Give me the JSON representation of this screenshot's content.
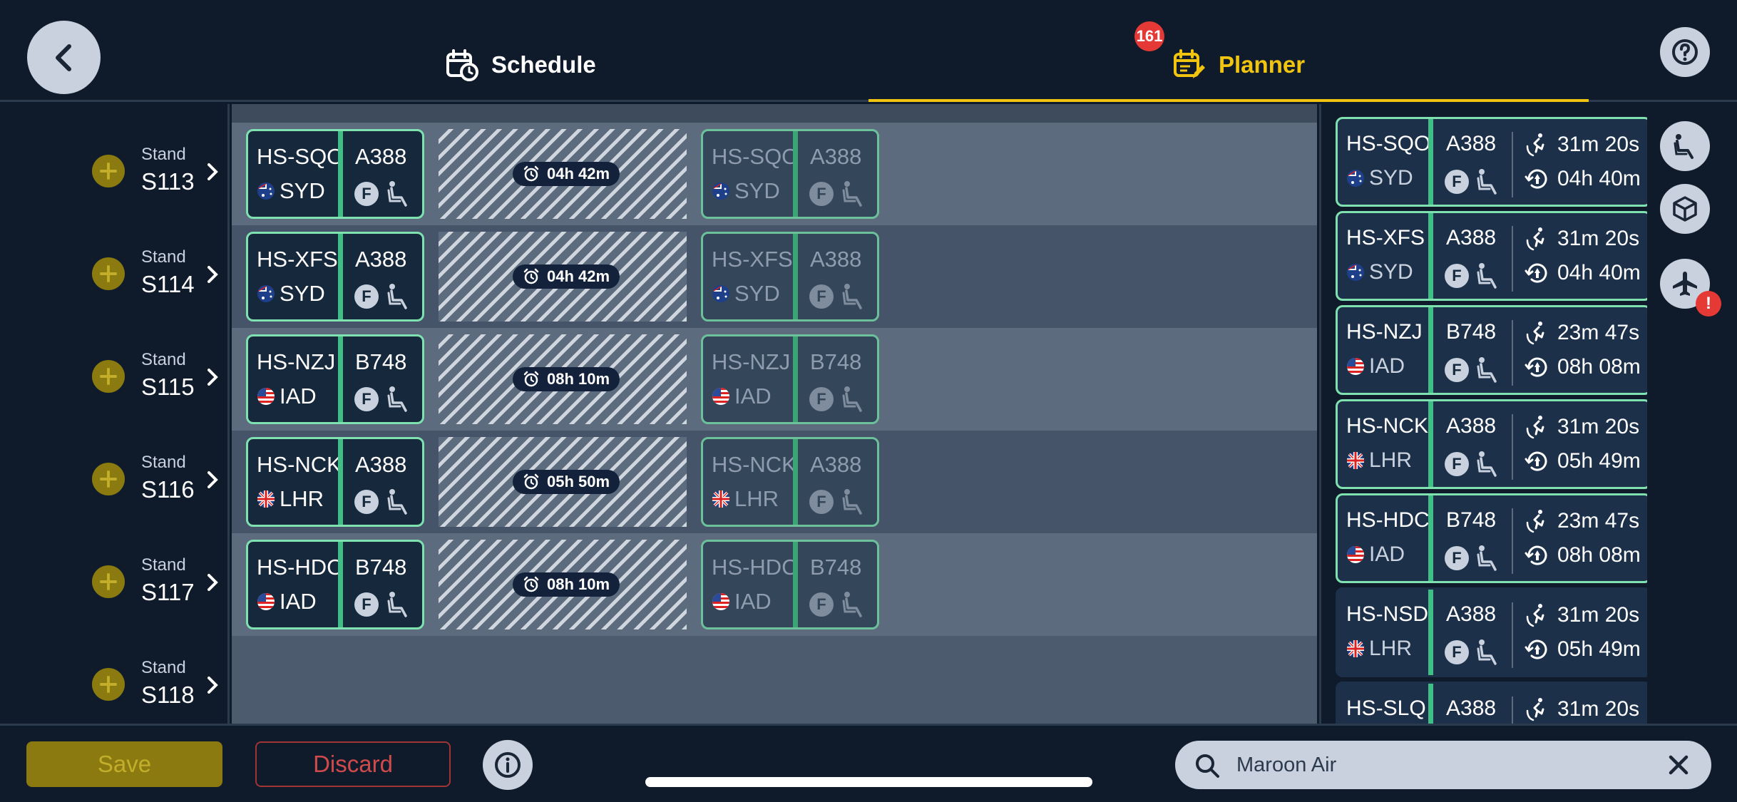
{
  "header": {
    "tabs": [
      {
        "label": "Schedule",
        "icon": "calendar-clock-icon"
      },
      {
        "label": "Planner",
        "icon": "calendar-edit-icon",
        "badge": "161"
      }
    ]
  },
  "stands": [
    {
      "label": "Stand",
      "name": "S113"
    },
    {
      "label": "Stand",
      "name": "S114"
    },
    {
      "label": "Stand",
      "name": "S115"
    },
    {
      "label": "Stand",
      "name": "S116"
    },
    {
      "label": "Stand",
      "name": "S117"
    },
    {
      "label": "Stand",
      "name": "S118"
    }
  ],
  "timeline": [
    {
      "reg": "HS-SQO",
      "origin": "SYD",
      "flag": "au",
      "type": "A388",
      "class": "F",
      "duration": "04h 42m"
    },
    {
      "reg": "HS-XFS",
      "origin": "SYD",
      "flag": "au",
      "type": "A388",
      "class": "F",
      "duration": "04h 42m"
    },
    {
      "reg": "HS-NZJ",
      "origin": "IAD",
      "flag": "us",
      "type": "B748",
      "class": "F",
      "duration": "08h 10m"
    },
    {
      "reg": "HS-NCK",
      "origin": "LHR",
      "flag": "gb",
      "type": "A388",
      "class": "F",
      "duration": "05h 50m"
    },
    {
      "reg": "HS-HDC",
      "origin": "IAD",
      "flag": "us",
      "type": "B748",
      "class": "F",
      "duration": "08h 10m"
    }
  ],
  "flights": [
    {
      "reg": "HS-SQO",
      "origin": "SYD",
      "flag": "au",
      "type": "A388",
      "class": "F",
      "time1": "31m 20s",
      "time2": "04h 40m",
      "selected": true
    },
    {
      "reg": "HS-XFS",
      "origin": "SYD",
      "flag": "au",
      "type": "A388",
      "class": "F",
      "time1": "31m 20s",
      "time2": "04h 40m",
      "selected": true
    },
    {
      "reg": "HS-NZJ",
      "origin": "IAD",
      "flag": "us",
      "type": "B748",
      "class": "F",
      "time1": "23m 47s",
      "time2": "08h 08m",
      "selected": true
    },
    {
      "reg": "HS-NCK",
      "origin": "LHR",
      "flag": "gb",
      "type": "A388",
      "class": "F",
      "time1": "31m 20s",
      "time2": "05h 49m",
      "selected": true
    },
    {
      "reg": "HS-HDC",
      "origin": "IAD",
      "flag": "us",
      "type": "B748",
      "class": "F",
      "time1": "23m 47s",
      "time2": "08h 08m",
      "selected": true
    },
    {
      "reg": "HS-NSD",
      "origin": "LHR",
      "flag": "gb",
      "type": "A388",
      "class": "F",
      "time1": "31m 20s",
      "time2": "05h 49m",
      "selected": false
    },
    {
      "reg": "HS-SLQ",
      "origin": "",
      "flag": "",
      "type": "A388",
      "class": "",
      "time1": "31m 20s",
      "time2": "",
      "selected": false
    }
  ],
  "side_buttons": [
    {
      "icon": "passenger-seat-icon"
    },
    {
      "icon": "cargo-box-icon"
    },
    {
      "icon": "airplane-icon",
      "alert": "!"
    }
  ],
  "bottom": {
    "save_label": "Save",
    "discard_label": "Discard",
    "search_value": "Maroon Air"
  },
  "colors": {
    "accent": "#f1c40f",
    "card_border": "#7fe0b0",
    "card_divider": "#3fbf86",
    "badge": "#e53935",
    "background": "#0f1b2a"
  }
}
